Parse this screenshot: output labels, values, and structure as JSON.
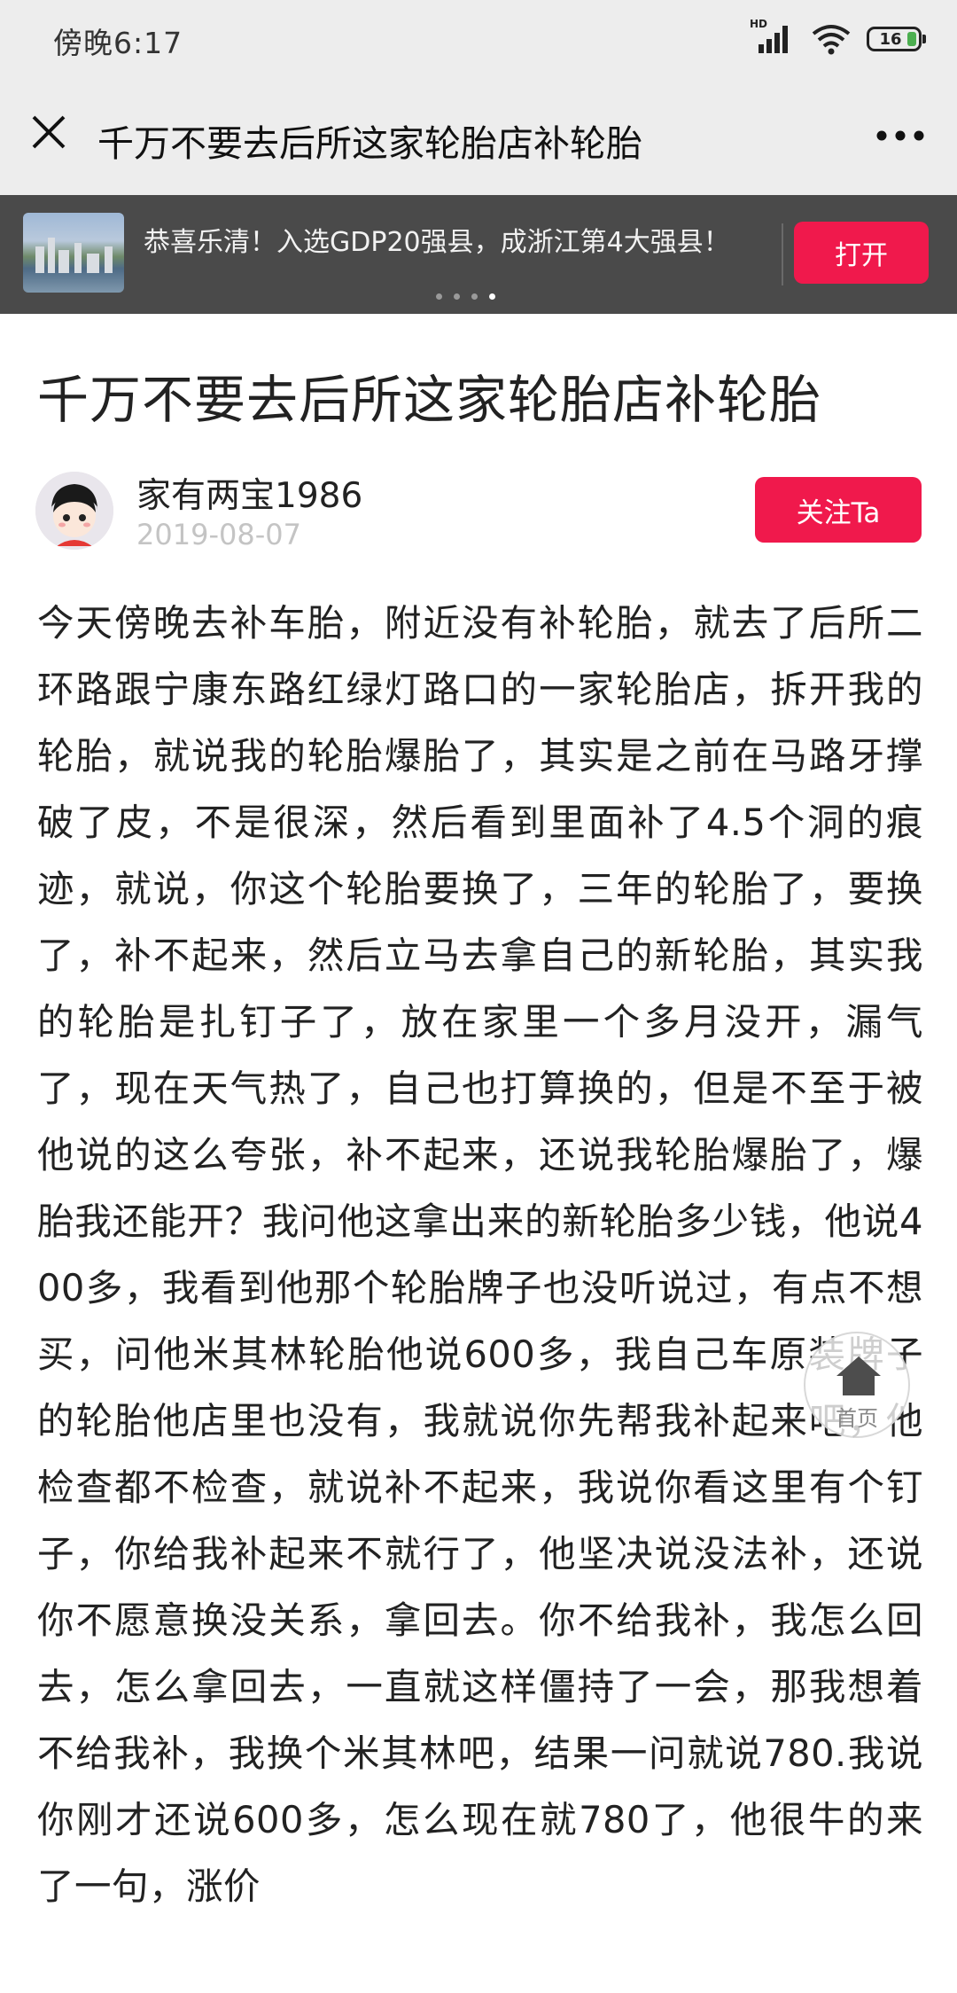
{
  "status_bar": {
    "time": "傍晚6:17",
    "network_badge": "HD",
    "battery_level": "16",
    "icons": [
      "signal-icon",
      "wifi-icon",
      "battery-icon"
    ]
  },
  "app_bar": {
    "title": "千万不要去后所这家轮胎店补轮胎",
    "close_icon": "close-icon",
    "more_icon": "more-icon"
  },
  "banner": {
    "text": "恭喜乐清！入选GDP20强县，成浙江第4大强县！",
    "open_label": "打开",
    "carousel_count": 4,
    "carousel_active_index": 3
  },
  "article": {
    "title": "千万不要去后所这家轮胎店补轮胎",
    "author": "家有两宝1986",
    "date": "2019-08-07",
    "follow_label": "关注Ta",
    "body": "今天傍晚去补车胎，附近没有补轮胎，就去了后所二环路跟宁康东路红绿灯路口的一家轮胎店，拆开我的轮胎，就说我的轮胎爆胎了，其实是之前在马路牙撑破了皮，不是很深，然后看到里面补了4.5个洞的痕迹，就说，你这个轮胎要换了，三年的轮胎了，要换了，补不起来，然后立马去拿自己的新轮胎，其实我的轮胎是扎钉子了，放在家里一个多月没开，漏气了，现在天气热了，自己也打算换的，但是不至于被他说的这么夸张，补不起来，还说我轮胎爆胎了，爆胎我还能开？我问他这拿出来的新轮胎多少钱，他说400多，我看到他那个轮胎牌子也没听说过，有点不想买，问他米其林轮胎他说600多，我自己车原装牌子的轮胎他店里也没有，我就说你先帮我补起来吧，他检查都不检查，就说补不起来，我说你看这里有个钉子，你给我补起来不就行了，他坚决说没法补，还说你不愿意换没关系，拿回去。你不给我补，我怎么回去，怎么拿回去，一直就这样僵持了一会，那我想着不给我补，我换个米其林吧，结果一问就说780.我说你刚才还说600多，怎么现在就780了，他很牛的来了一句，涨价"
  },
  "home_fab": {
    "label": "首页",
    "icon": "home-icon"
  },
  "colors": {
    "accent": "#f0194c",
    "bar_bg": "#ededed",
    "banner_bg": "#4a4a4a"
  }
}
